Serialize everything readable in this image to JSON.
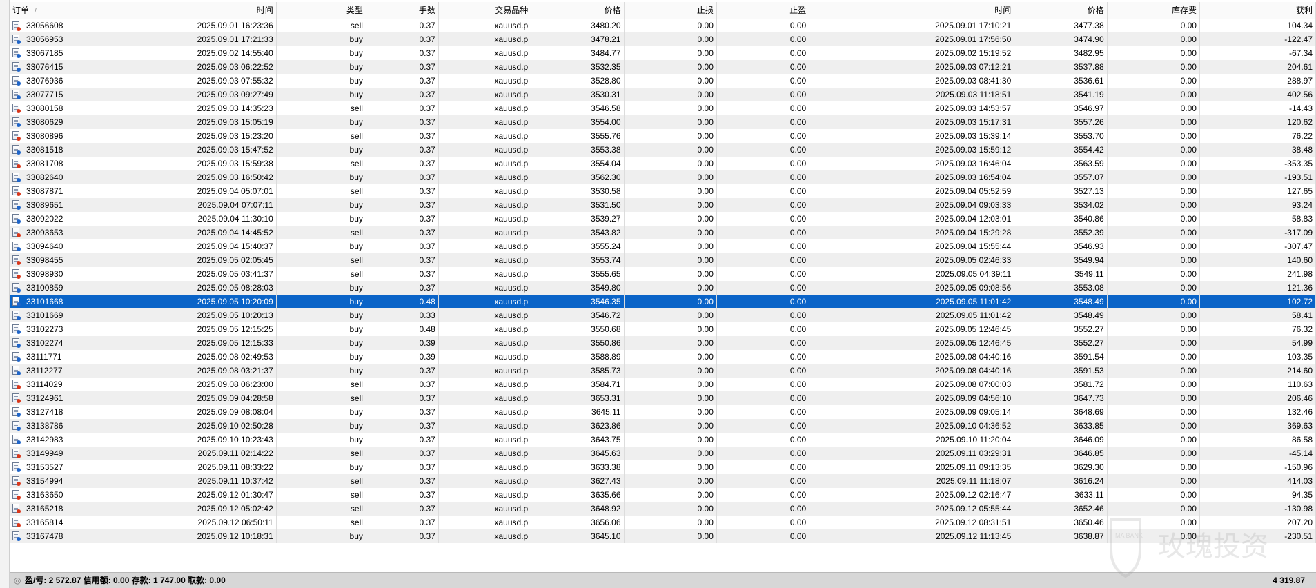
{
  "columns": [
    "订单",
    "时间",
    "类型",
    "手数",
    "交易品种",
    "价格",
    "止损",
    "止盈",
    "时间",
    "价格",
    "库存费",
    "获利"
  ],
  "sort_indicator": "/",
  "selected_index": 20,
  "rows": [
    {
      "order": "33056608",
      "open_time": "2025.09.01 16:23:36",
      "type": "sell",
      "volume": "0.37",
      "symbol": "xauusd.p",
      "open_price": "3480.20",
      "sl": "0.00",
      "tp": "0.00",
      "close_time": "2025.09.01 17:10:21",
      "close_price": "3477.38",
      "swap": "0.00",
      "profit": "104.34"
    },
    {
      "order": "33056953",
      "open_time": "2025.09.01 17:21:33",
      "type": "buy",
      "volume": "0.37",
      "symbol": "xauusd.p",
      "open_price": "3478.21",
      "sl": "0.00",
      "tp": "0.00",
      "close_time": "2025.09.01 17:56:50",
      "close_price": "3474.90",
      "swap": "0.00",
      "profit": "-122.47"
    },
    {
      "order": "33067185",
      "open_time": "2025.09.02 14:55:40",
      "type": "buy",
      "volume": "0.37",
      "symbol": "xauusd.p",
      "open_price": "3484.77",
      "sl": "0.00",
      "tp": "0.00",
      "close_time": "2025.09.02 15:19:52",
      "close_price": "3482.95",
      "swap": "0.00",
      "profit": "-67.34"
    },
    {
      "order": "33076415",
      "open_time": "2025.09.03 06:22:52",
      "type": "buy",
      "volume": "0.37",
      "symbol": "xauusd.p",
      "open_price": "3532.35",
      "sl": "0.00",
      "tp": "0.00",
      "close_time": "2025.09.03 07:12:21",
      "close_price": "3537.88",
      "swap": "0.00",
      "profit": "204.61"
    },
    {
      "order": "33076936",
      "open_time": "2025.09.03 07:55:32",
      "type": "buy",
      "volume": "0.37",
      "symbol": "xauusd.p",
      "open_price": "3528.80",
      "sl": "0.00",
      "tp": "0.00",
      "close_time": "2025.09.03 08:41:30",
      "close_price": "3536.61",
      "swap": "0.00",
      "profit": "288.97"
    },
    {
      "order": "33077715",
      "open_time": "2025.09.03 09:27:49",
      "type": "buy",
      "volume": "0.37",
      "symbol": "xauusd.p",
      "open_price": "3530.31",
      "sl": "0.00",
      "tp": "0.00",
      "close_time": "2025.09.03 11:18:51",
      "close_price": "3541.19",
      "swap": "0.00",
      "profit": "402.56"
    },
    {
      "order": "33080158",
      "open_time": "2025.09.03 14:35:23",
      "type": "sell",
      "volume": "0.37",
      "symbol": "xauusd.p",
      "open_price": "3546.58",
      "sl": "0.00",
      "tp": "0.00",
      "close_time": "2025.09.03 14:53:57",
      "close_price": "3546.97",
      "swap": "0.00",
      "profit": "-14.43"
    },
    {
      "order": "33080629",
      "open_time": "2025.09.03 15:05:19",
      "type": "buy",
      "volume": "0.37",
      "symbol": "xauusd.p",
      "open_price": "3554.00",
      "sl": "0.00",
      "tp": "0.00",
      "close_time": "2025.09.03 15:17:31",
      "close_price": "3557.26",
      "swap": "0.00",
      "profit": "120.62"
    },
    {
      "order": "33080896",
      "open_time": "2025.09.03 15:23:20",
      "type": "sell",
      "volume": "0.37",
      "symbol": "xauusd.p",
      "open_price": "3555.76",
      "sl": "0.00",
      "tp": "0.00",
      "close_time": "2025.09.03 15:39:14",
      "close_price": "3553.70",
      "swap": "0.00",
      "profit": "76.22"
    },
    {
      "order": "33081518",
      "open_time": "2025.09.03 15:47:52",
      "type": "buy",
      "volume": "0.37",
      "symbol": "xauusd.p",
      "open_price": "3553.38",
      "sl": "0.00",
      "tp": "0.00",
      "close_time": "2025.09.03 15:59:12",
      "close_price": "3554.42",
      "swap": "0.00",
      "profit": "38.48"
    },
    {
      "order": "33081708",
      "open_time": "2025.09.03 15:59:38",
      "type": "sell",
      "volume": "0.37",
      "symbol": "xauusd.p",
      "open_price": "3554.04",
      "sl": "0.00",
      "tp": "0.00",
      "close_time": "2025.09.03 16:46:04",
      "close_price": "3563.59",
      "swap": "0.00",
      "profit": "-353.35"
    },
    {
      "order": "33082640",
      "open_time": "2025.09.03 16:50:42",
      "type": "buy",
      "volume": "0.37",
      "symbol": "xauusd.p",
      "open_price": "3562.30",
      "sl": "0.00",
      "tp": "0.00",
      "close_time": "2025.09.03 16:54:04",
      "close_price": "3557.07",
      "swap": "0.00",
      "profit": "-193.51"
    },
    {
      "order": "33087871",
      "open_time": "2025.09.04 05:07:01",
      "type": "sell",
      "volume": "0.37",
      "symbol": "xauusd.p",
      "open_price": "3530.58",
      "sl": "0.00",
      "tp": "0.00",
      "close_time": "2025.09.04 05:52:59",
      "close_price": "3527.13",
      "swap": "0.00",
      "profit": "127.65"
    },
    {
      "order": "33089651",
      "open_time": "2025.09.04 07:07:11",
      "type": "buy",
      "volume": "0.37",
      "symbol": "xauusd.p",
      "open_price": "3531.50",
      "sl": "0.00",
      "tp": "0.00",
      "close_time": "2025.09.04 09:03:33",
      "close_price": "3534.02",
      "swap": "0.00",
      "profit": "93.24"
    },
    {
      "order": "33092022",
      "open_time": "2025.09.04 11:30:10",
      "type": "buy",
      "volume": "0.37",
      "symbol": "xauusd.p",
      "open_price": "3539.27",
      "sl": "0.00",
      "tp": "0.00",
      "close_time": "2025.09.04 12:03:01",
      "close_price": "3540.86",
      "swap": "0.00",
      "profit": "58.83"
    },
    {
      "order": "33093653",
      "open_time": "2025.09.04 14:45:52",
      "type": "sell",
      "volume": "0.37",
      "symbol": "xauusd.p",
      "open_price": "3543.82",
      "sl": "0.00",
      "tp": "0.00",
      "close_time": "2025.09.04 15:29:28",
      "close_price": "3552.39",
      "swap": "0.00",
      "profit": "-317.09"
    },
    {
      "order": "33094640",
      "open_time": "2025.09.04 15:40:37",
      "type": "buy",
      "volume": "0.37",
      "symbol": "xauusd.p",
      "open_price": "3555.24",
      "sl": "0.00",
      "tp": "0.00",
      "close_time": "2025.09.04 15:55:44",
      "close_price": "3546.93",
      "swap": "0.00",
      "profit": "-307.47"
    },
    {
      "order": "33098455",
      "open_time": "2025.09.05 02:05:45",
      "type": "sell",
      "volume": "0.37",
      "symbol": "xauusd.p",
      "open_price": "3553.74",
      "sl": "0.00",
      "tp": "0.00",
      "close_time": "2025.09.05 02:46:33",
      "close_price": "3549.94",
      "swap": "0.00",
      "profit": "140.60"
    },
    {
      "order": "33098930",
      "open_time": "2025.09.05 03:41:37",
      "type": "sell",
      "volume": "0.37",
      "symbol": "xauusd.p",
      "open_price": "3555.65",
      "sl": "0.00",
      "tp": "0.00",
      "close_time": "2025.09.05 04:39:11",
      "close_price": "3549.11",
      "swap": "0.00",
      "profit": "241.98"
    },
    {
      "order": "33100859",
      "open_time": "2025.09.05 08:28:03",
      "type": "buy",
      "volume": "0.37",
      "symbol": "xauusd.p",
      "open_price": "3549.80",
      "sl": "0.00",
      "tp": "0.00",
      "close_time": "2025.09.05 09:08:56",
      "close_price": "3553.08",
      "swap": "0.00",
      "profit": "121.36"
    },
    {
      "order": "33101668",
      "open_time": "2025.09.05 10:20:09",
      "type": "buy",
      "volume": "0.48",
      "symbol": "xauusd.p",
      "open_price": "3546.35",
      "sl": "0.00",
      "tp": "0.00",
      "close_time": "2025.09.05 11:01:42",
      "close_price": "3548.49",
      "swap": "0.00",
      "profit": "102.72"
    },
    {
      "order": "33101669",
      "open_time": "2025.09.05 10:20:13",
      "type": "buy",
      "volume": "0.33",
      "symbol": "xauusd.p",
      "open_price": "3546.72",
      "sl": "0.00",
      "tp": "0.00",
      "close_time": "2025.09.05 11:01:42",
      "close_price": "3548.49",
      "swap": "0.00",
      "profit": "58.41"
    },
    {
      "order": "33102273",
      "open_time": "2025.09.05 12:15:25",
      "type": "buy",
      "volume": "0.48",
      "symbol": "xauusd.p",
      "open_price": "3550.68",
      "sl": "0.00",
      "tp": "0.00",
      "close_time": "2025.09.05 12:46:45",
      "close_price": "3552.27",
      "swap": "0.00",
      "profit": "76.32"
    },
    {
      "order": "33102274",
      "open_time": "2025.09.05 12:15:33",
      "type": "buy",
      "volume": "0.39",
      "symbol": "xauusd.p",
      "open_price": "3550.86",
      "sl": "0.00",
      "tp": "0.00",
      "close_time": "2025.09.05 12:46:45",
      "close_price": "3552.27",
      "swap": "0.00",
      "profit": "54.99"
    },
    {
      "order": "33111771",
      "open_time": "2025.09.08 02:49:53",
      "type": "buy",
      "volume": "0.39",
      "symbol": "xauusd.p",
      "open_price": "3588.89",
      "sl": "0.00",
      "tp": "0.00",
      "close_time": "2025.09.08 04:40:16",
      "close_price": "3591.54",
      "swap": "0.00",
      "profit": "103.35"
    },
    {
      "order": "33112277",
      "open_time": "2025.09.08 03:21:37",
      "type": "buy",
      "volume": "0.37",
      "symbol": "xauusd.p",
      "open_price": "3585.73",
      "sl": "0.00",
      "tp": "0.00",
      "close_time": "2025.09.08 04:40:16",
      "close_price": "3591.53",
      "swap": "0.00",
      "profit": "214.60"
    },
    {
      "order": "33114029",
      "open_time": "2025.09.08 06:23:00",
      "type": "sell",
      "volume": "0.37",
      "symbol": "xauusd.p",
      "open_price": "3584.71",
      "sl": "0.00",
      "tp": "0.00",
      "close_time": "2025.09.08 07:00:03",
      "close_price": "3581.72",
      "swap": "0.00",
      "profit": "110.63"
    },
    {
      "order": "33124961",
      "open_time": "2025.09.09 04:28:58",
      "type": "sell",
      "volume": "0.37",
      "symbol": "xauusd.p",
      "open_price": "3653.31",
      "sl": "0.00",
      "tp": "0.00",
      "close_time": "2025.09.09 04:56:10",
      "close_price": "3647.73",
      "swap": "0.00",
      "profit": "206.46"
    },
    {
      "order": "33127418",
      "open_time": "2025.09.09 08:08:04",
      "type": "buy",
      "volume": "0.37",
      "symbol": "xauusd.p",
      "open_price": "3645.11",
      "sl": "0.00",
      "tp": "0.00",
      "close_time": "2025.09.09 09:05:14",
      "close_price": "3648.69",
      "swap": "0.00",
      "profit": "132.46"
    },
    {
      "order": "33138786",
      "open_time": "2025.09.10 02:50:28",
      "type": "buy",
      "volume": "0.37",
      "symbol": "xauusd.p",
      "open_price": "3623.86",
      "sl": "0.00",
      "tp": "0.00",
      "close_time": "2025.09.10 04:36:52",
      "close_price": "3633.85",
      "swap": "0.00",
      "profit": "369.63"
    },
    {
      "order": "33142983",
      "open_time": "2025.09.10 10:23:43",
      "type": "buy",
      "volume": "0.37",
      "symbol": "xauusd.p",
      "open_price": "3643.75",
      "sl": "0.00",
      "tp": "0.00",
      "close_time": "2025.09.10 11:20:04",
      "close_price": "3646.09",
      "swap": "0.00",
      "profit": "86.58"
    },
    {
      "order": "33149949",
      "open_time": "2025.09.11 02:14:22",
      "type": "sell",
      "volume": "0.37",
      "symbol": "xauusd.p",
      "open_price": "3645.63",
      "sl": "0.00",
      "tp": "0.00",
      "close_time": "2025.09.11 03:29:31",
      "close_price": "3646.85",
      "swap": "0.00",
      "profit": "-45.14"
    },
    {
      "order": "33153527",
      "open_time": "2025.09.11 08:33:22",
      "type": "buy",
      "volume": "0.37",
      "symbol": "xauusd.p",
      "open_price": "3633.38",
      "sl": "0.00",
      "tp": "0.00",
      "close_time": "2025.09.11 09:13:35",
      "close_price": "3629.30",
      "swap": "0.00",
      "profit": "-150.96"
    },
    {
      "order": "33154994",
      "open_time": "2025.09.11 10:37:42",
      "type": "sell",
      "volume": "0.37",
      "symbol": "xauusd.p",
      "open_price": "3627.43",
      "sl": "0.00",
      "tp": "0.00",
      "close_time": "2025.09.11 11:18:07",
      "close_price": "3616.24",
      "swap": "0.00",
      "profit": "414.03"
    },
    {
      "order": "33163650",
      "open_time": "2025.09.12 01:30:47",
      "type": "sell",
      "volume": "0.37",
      "symbol": "xauusd.p",
      "open_price": "3635.66",
      "sl": "0.00",
      "tp": "0.00",
      "close_time": "2025.09.12 02:16:47",
      "close_price": "3633.11",
      "swap": "0.00",
      "profit": "94.35"
    },
    {
      "order": "33165218",
      "open_time": "2025.09.12 05:02:42",
      "type": "sell",
      "volume": "0.37",
      "symbol": "xauusd.p",
      "open_price": "3648.92",
      "sl": "0.00",
      "tp": "0.00",
      "close_time": "2025.09.12 05:55:44",
      "close_price": "3652.46",
      "swap": "0.00",
      "profit": "-130.98"
    },
    {
      "order": "33165814",
      "open_time": "2025.09.12 06:50:11",
      "type": "sell",
      "volume": "0.37",
      "symbol": "xauusd.p",
      "open_price": "3656.06",
      "sl": "0.00",
      "tp": "0.00",
      "close_time": "2025.09.12 08:31:51",
      "close_price": "3650.46",
      "swap": "0.00",
      "profit": "207.20"
    },
    {
      "order": "33167478",
      "open_time": "2025.09.12 10:18:31",
      "type": "buy",
      "volume": "0.37",
      "symbol": "xauusd.p",
      "open_price": "3645.10",
      "sl": "0.00",
      "tp": "0.00",
      "close_time": "2025.09.12 11:13:45",
      "close_price": "3638.87",
      "swap": "0.00",
      "profit": "-230.51"
    }
  ],
  "summary": {
    "text": "盈/亏: 2 572.87  信用额: 0.00  存款: 1 747.00  取款: 0.00",
    "total": "4 319.87"
  },
  "watermark": {
    "text": "玫瑰投资",
    "sub": "MA BANK"
  },
  "colors": {
    "selected_row": "#0a64c8",
    "sell_mark": "#d9371b",
    "buy_mark": "#1f65c9"
  }
}
